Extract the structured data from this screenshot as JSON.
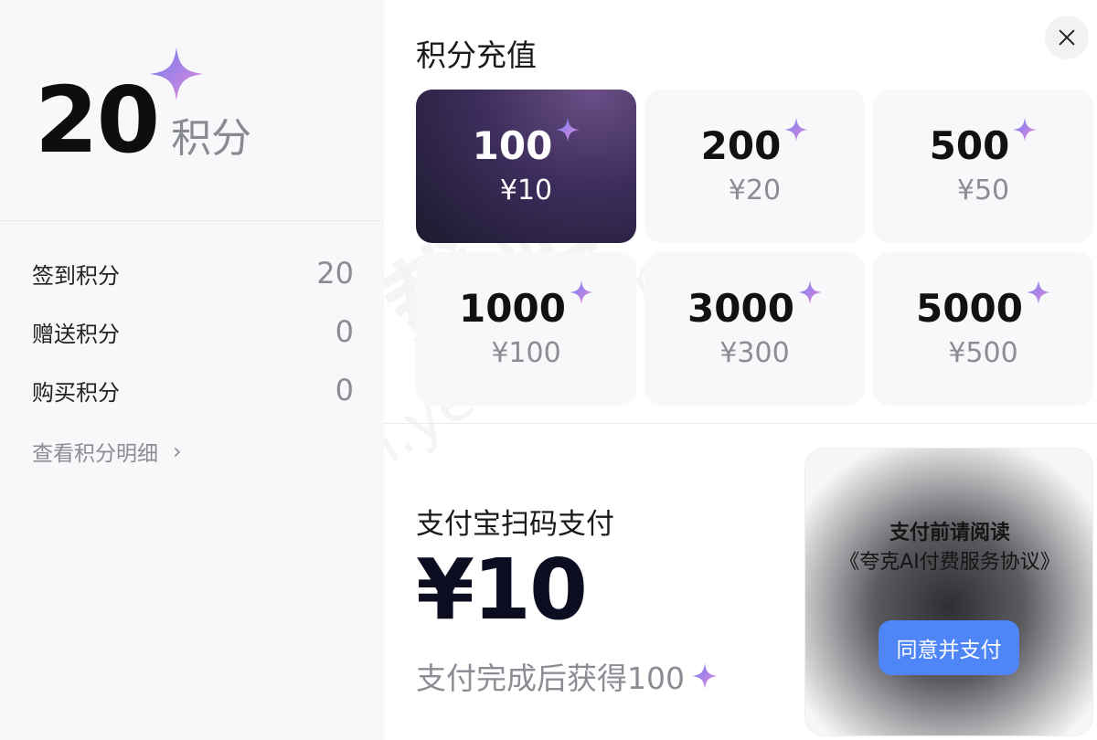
{
  "sidebar": {
    "balance": {
      "value": "20",
      "unit": "积分"
    },
    "stats": [
      {
        "label": "签到积分",
        "value": "20"
      },
      {
        "label": "赠送积分",
        "value": "0"
      },
      {
        "label": "购买积分",
        "value": "0"
      }
    ],
    "detail_link": "查看积分明细"
  },
  "main": {
    "title": "积分充值",
    "packages": [
      {
        "points": "100",
        "price": "¥10",
        "selected": true
      },
      {
        "points": "200",
        "price": "¥20",
        "selected": false
      },
      {
        "points": "500",
        "price": "¥50",
        "selected": false
      },
      {
        "points": "1000",
        "price": "¥100",
        "selected": false
      },
      {
        "points": "3000",
        "price": "¥300",
        "selected": false
      },
      {
        "points": "5000",
        "price": "¥500",
        "selected": false
      }
    ],
    "payment": {
      "method": "支付宝扫码支付",
      "amount": "¥10",
      "gain_text": "支付完成后获得100"
    },
    "notice": {
      "title": "支付前请阅读",
      "agreement": "《夸克AI付费服务协议》",
      "button": "同意并支付"
    }
  },
  "watermark": {
    "line1": "天极下载站",
    "line2": "mydown.yesky.com"
  },
  "icons": {
    "star": "sparkle-star-icon",
    "close": "close-icon",
    "chevron": "chevron-right-icon"
  },
  "colors": {
    "accent_blue": "#4f86f7",
    "selected_card": "#2a2340",
    "star_gradient_start": "#7b6cf6",
    "star_gradient_end": "#e37bd9"
  }
}
